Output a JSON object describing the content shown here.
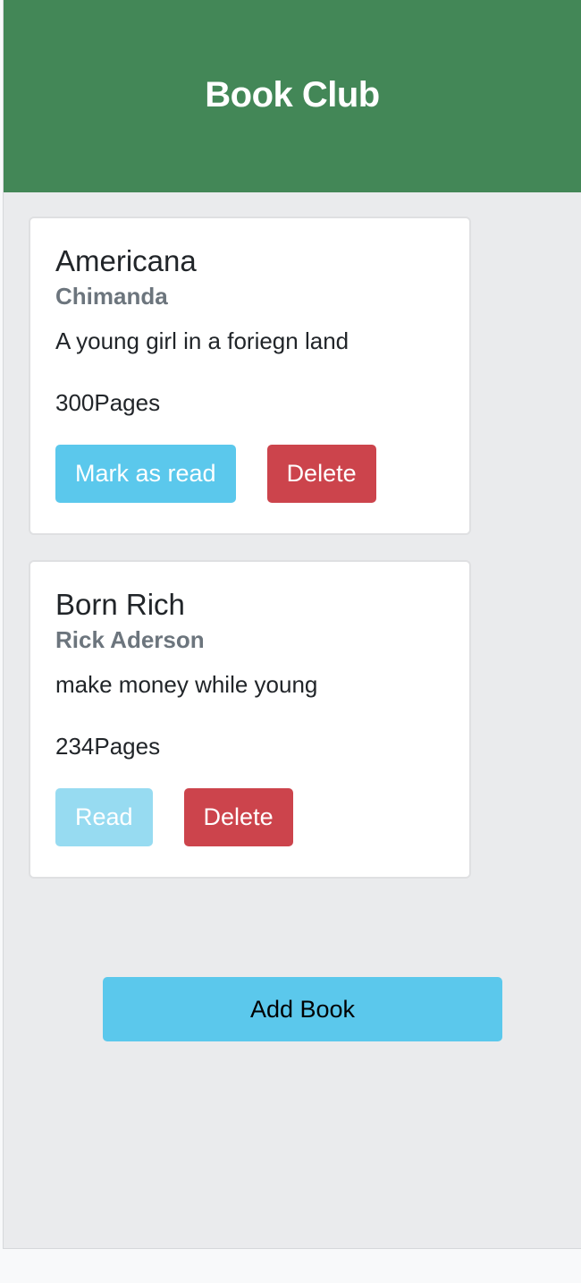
{
  "header": {
    "title": "Book Club"
  },
  "books": [
    {
      "title": "Americana",
      "author": "Chimanda",
      "description": "A young girl in a foriegn land",
      "pages": "300Pages",
      "read_button": "Mark as read",
      "delete_button": "Delete"
    },
    {
      "title": "Born Rich",
      "author": "Rick Aderson",
      "description": "make money while young",
      "pages": "234Pages",
      "read_button": "Read",
      "delete_button": "Delete"
    }
  ],
  "actions": {
    "add_book": "Add Book"
  },
  "colors": {
    "header": "#438757",
    "info": "#5bc8ec",
    "info_disabled": "#97dbf1",
    "danger": "#cc444c"
  }
}
